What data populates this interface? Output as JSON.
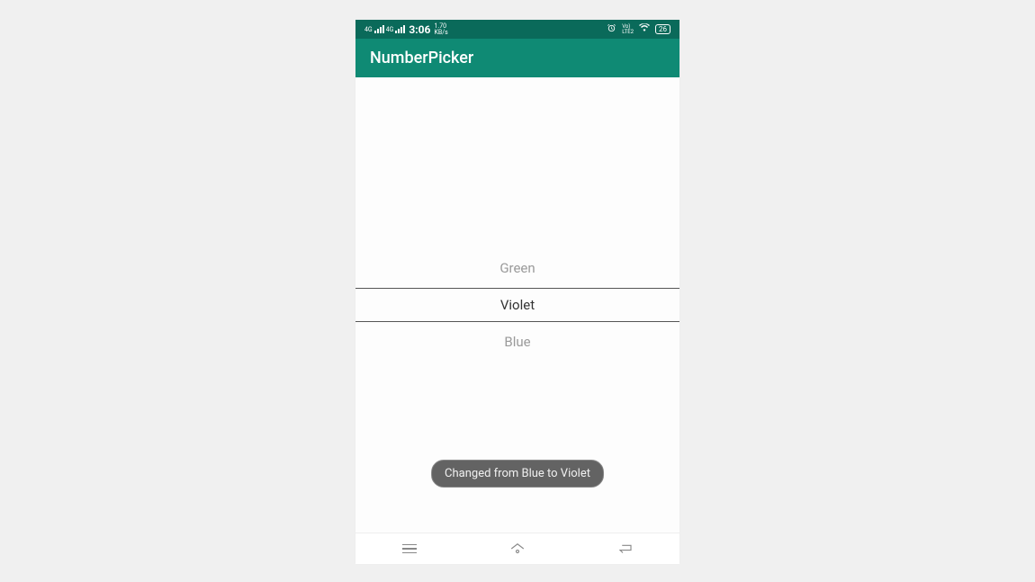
{
  "status_bar": {
    "network_type": "4G",
    "time": "3:06",
    "data_rate_value": "1.70",
    "data_rate_unit": "KB/s",
    "volte_label_1": "Vo)",
    "volte_label_2": "LTE2",
    "battery_level": "26"
  },
  "app_bar": {
    "title": "NumberPicker"
  },
  "picker": {
    "prev": "Green",
    "selected": "Violet",
    "next": "Blue"
  },
  "toast": {
    "message": "Changed from Blue to Violet"
  }
}
